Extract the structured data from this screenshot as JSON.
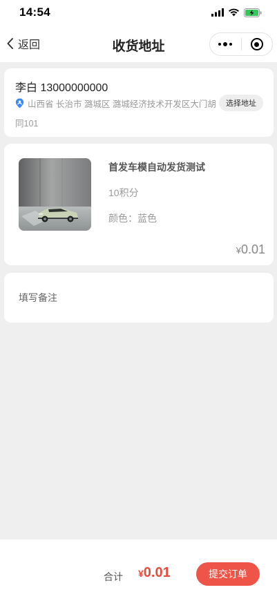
{
  "status_bar": {
    "time": "14:54"
  },
  "nav": {
    "back_label": "返回",
    "title": "收货地址",
    "icons": {
      "back": "chevron-left-icon",
      "more": "more-dots-icon",
      "close": "target-icon"
    }
  },
  "address": {
    "name_phone": "李白 13000000000",
    "detail": "山西省 长治市 潞城区 潞城经济技术开发区大门胡同101",
    "select_button": "选择地址",
    "icon": "location-pin-icon",
    "icon_color": "#3d8af7"
  },
  "product": {
    "name": "首发车模自动发货测试",
    "points": "10积分",
    "color": "颜色：蓝色",
    "price_symbol": "¥",
    "price": "0.01"
  },
  "remark": {
    "placeholder": "填写备注"
  },
  "footer": {
    "total_label": "合计",
    "total_symbol": "¥",
    "total_amount": "0.01",
    "submit_label": "提交订单",
    "accent_color": "#ee5548"
  }
}
